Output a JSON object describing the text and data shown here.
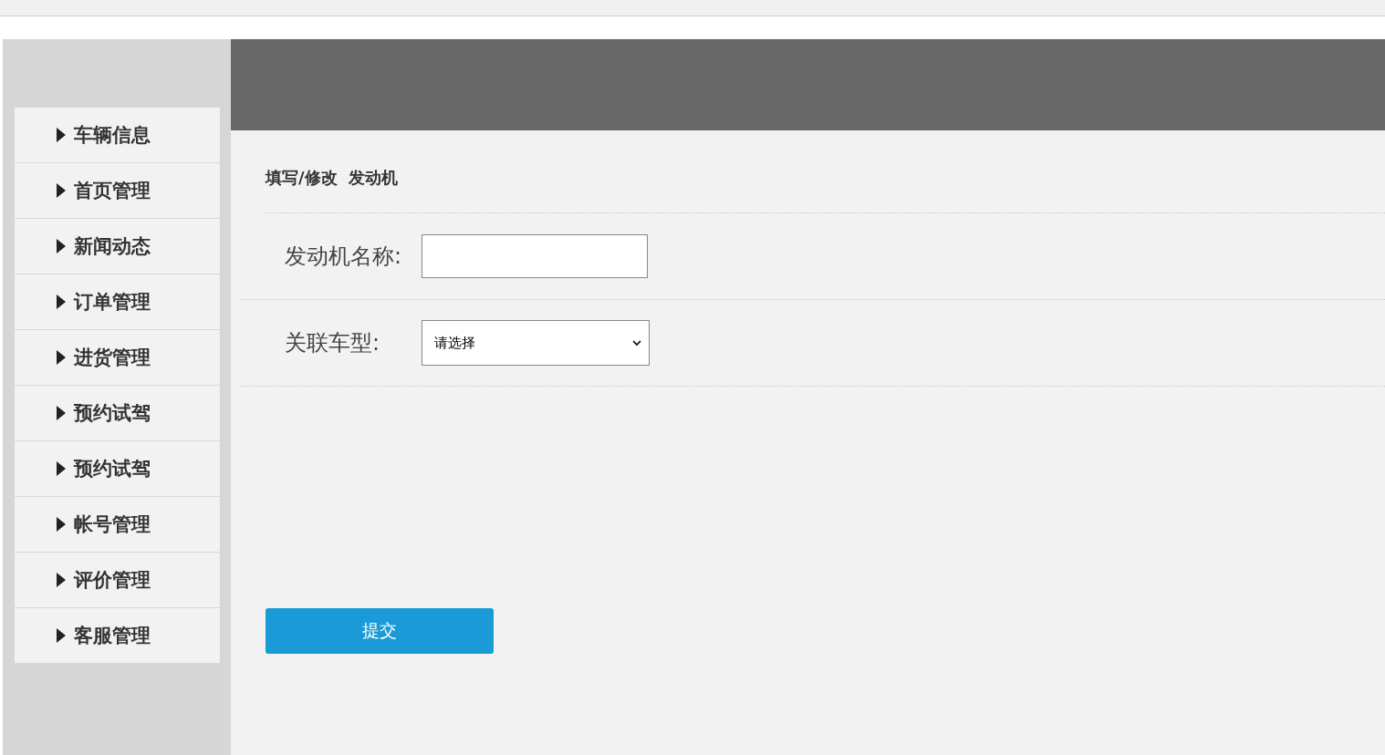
{
  "sidebar": {
    "items": [
      {
        "label": "车辆信息"
      },
      {
        "label": "首页管理"
      },
      {
        "label": "新闻动态"
      },
      {
        "label": "订单管理"
      },
      {
        "label": "进货管理"
      },
      {
        "label": "预约试驾"
      },
      {
        "label": "预约试驾"
      },
      {
        "label": "帐号管理"
      },
      {
        "label": "评价管理"
      },
      {
        "label": "客服管理"
      }
    ]
  },
  "form": {
    "title": "填写/修改  发动机",
    "fields": [
      {
        "kind": "text",
        "label": "发动机名称:"
      },
      {
        "kind": "select",
        "label": "关联车型:",
        "value": "请选择"
      }
    ],
    "submit": "提交"
  }
}
